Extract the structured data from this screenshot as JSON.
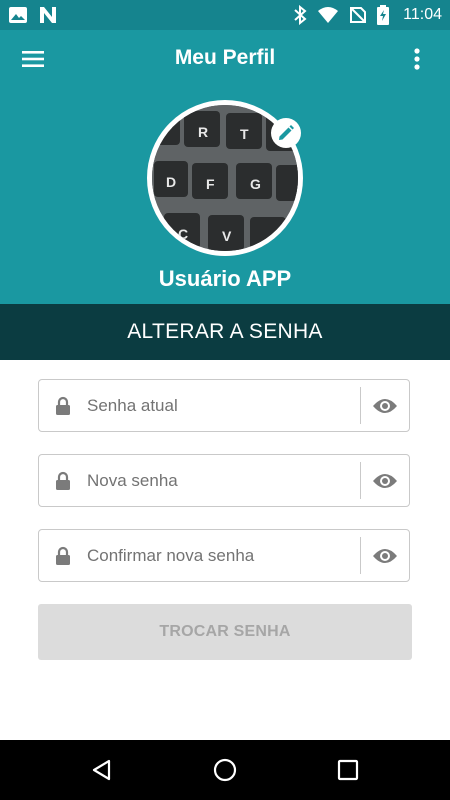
{
  "status_bar": {
    "time": "11:04",
    "left_icons": [
      "image-icon",
      "n-icon"
    ],
    "right_icons": [
      "bluetooth-icon",
      "wifi-icon",
      "no-sim-icon",
      "battery-charging-icon"
    ]
  },
  "app_bar": {
    "title": "Meu Perfil",
    "menu_icon": "menu-icon",
    "more_icon": "more-vert-icon",
    "background": "#1a98a1"
  },
  "profile": {
    "user_name": "Usuário APP",
    "avatar_keys": [
      "R",
      "T",
      "D",
      "F",
      "G",
      "C",
      "V"
    ],
    "edit_icon": "pencil-icon"
  },
  "section": {
    "title": "ALTERAR A SENHA",
    "background": "#0b3c41"
  },
  "form": {
    "current_password": {
      "placeholder": "Senha atual",
      "value": ""
    },
    "new_password": {
      "placeholder": "Nova senha",
      "value": ""
    },
    "confirm_password": {
      "placeholder": "Confirmar nova senha",
      "value": ""
    },
    "submit_label": "TROCAR SENHA"
  },
  "nav_bar": {
    "buttons": [
      "back-icon",
      "home-icon",
      "recents-icon"
    ]
  }
}
